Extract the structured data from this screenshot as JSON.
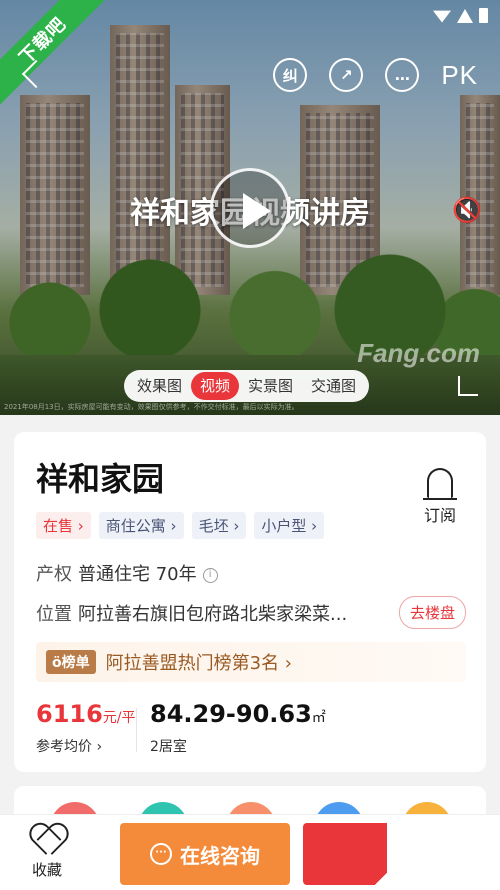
{
  "hero": {
    "ribbon": "下载吧",
    "title": "祥和家园视频讲房",
    "watermark": "Fang.com",
    "disclaimer": "2021年08月13日，实际房屋可能有变动，效果图仅供参考，不作交付标准，最后以实际为准。",
    "top_actions": [
      {
        "icon": "correction-icon",
        "glyph": "纠"
      },
      {
        "icon": "share-icon",
        "glyph": "↗"
      },
      {
        "icon": "message-icon",
        "glyph": "…"
      }
    ],
    "pk": "PK",
    "media_tabs": [
      "效果图",
      "视频",
      "实景图",
      "交通图"
    ],
    "active_tab": "视频"
  },
  "listing": {
    "name": "祥和家园",
    "subscribe": "订阅",
    "tags": [
      "在售 ›",
      "商住公寓 ›",
      "毛坯 ›",
      "小户型 ›"
    ],
    "property_label": "产权",
    "property_value": "普通住宅 70年",
    "info_glyph": "i",
    "location_label": "位置",
    "location_value": "阿拉善右旗旧包府路北柴家梁菜...",
    "goto_button": "去楼盘",
    "rank_badge": "ö榜单",
    "rank_text": "阿拉善盟热门榜第3名 ›",
    "price": "6116",
    "price_unit": "元/平",
    "price_label": "参考均价 ›",
    "area": "84.29-90.63",
    "area_unit": "㎡",
    "rooms": "2居室"
  },
  "bottom": {
    "favorite": "收藏",
    "consult": "在线咨询"
  },
  "colors": {
    "accent_red": "#e8363b",
    "consult_orange": "#f48b3b",
    "ribbon_green": "#2db24a"
  }
}
